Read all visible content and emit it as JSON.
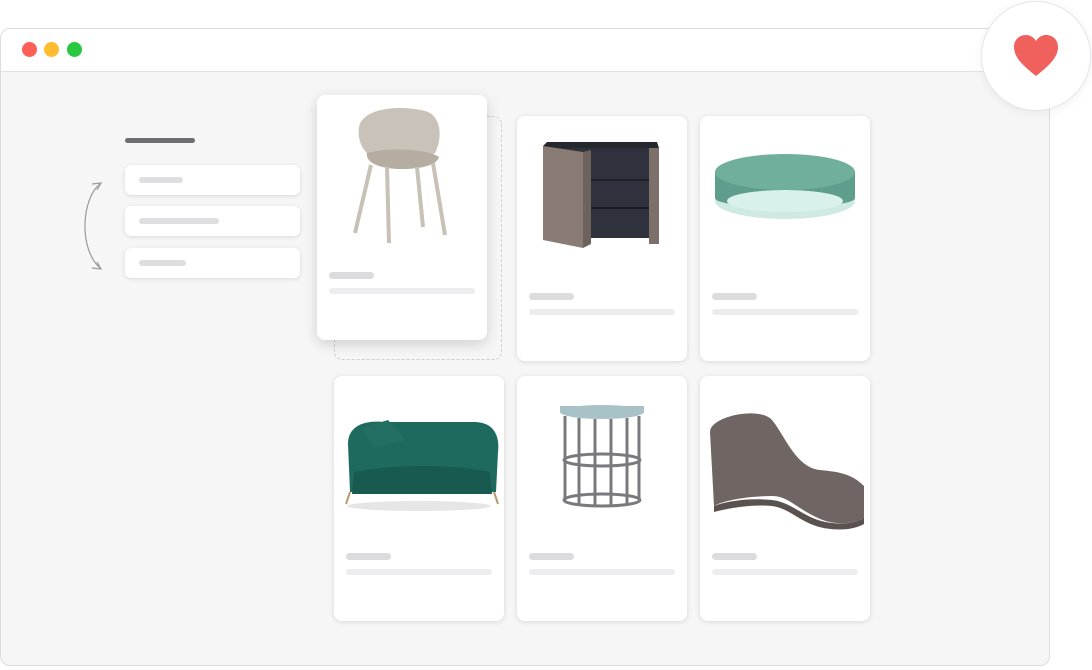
{
  "window": {
    "controls": [
      "close",
      "minimize",
      "maximize"
    ]
  },
  "favorite": {
    "icon": "heart-icon",
    "color": "#f0605c"
  },
  "sort_list": {
    "item_count": 3
  },
  "products": [
    {
      "icon": "chair-icon",
      "label": "",
      "description": ""
    },
    {
      "icon": "nightstand-icon",
      "label": "",
      "description": ""
    },
    {
      "icon": "ceiling-lamp-icon",
      "label": "",
      "description": ""
    },
    {
      "icon": "sofa-icon",
      "label": "",
      "description": ""
    },
    {
      "icon": "side-table-icon",
      "label": "",
      "description": ""
    },
    {
      "icon": "lounge-chair-icon",
      "label": "",
      "description": ""
    }
  ],
  "colors": {
    "close": "#ff5f57",
    "minimize": "#febc2e",
    "maximize": "#28c840",
    "sofa": "#1f6a5f",
    "lamp": "#5f9e8c",
    "lounge": "#6f6663",
    "nightstand": "#2f323c"
  }
}
